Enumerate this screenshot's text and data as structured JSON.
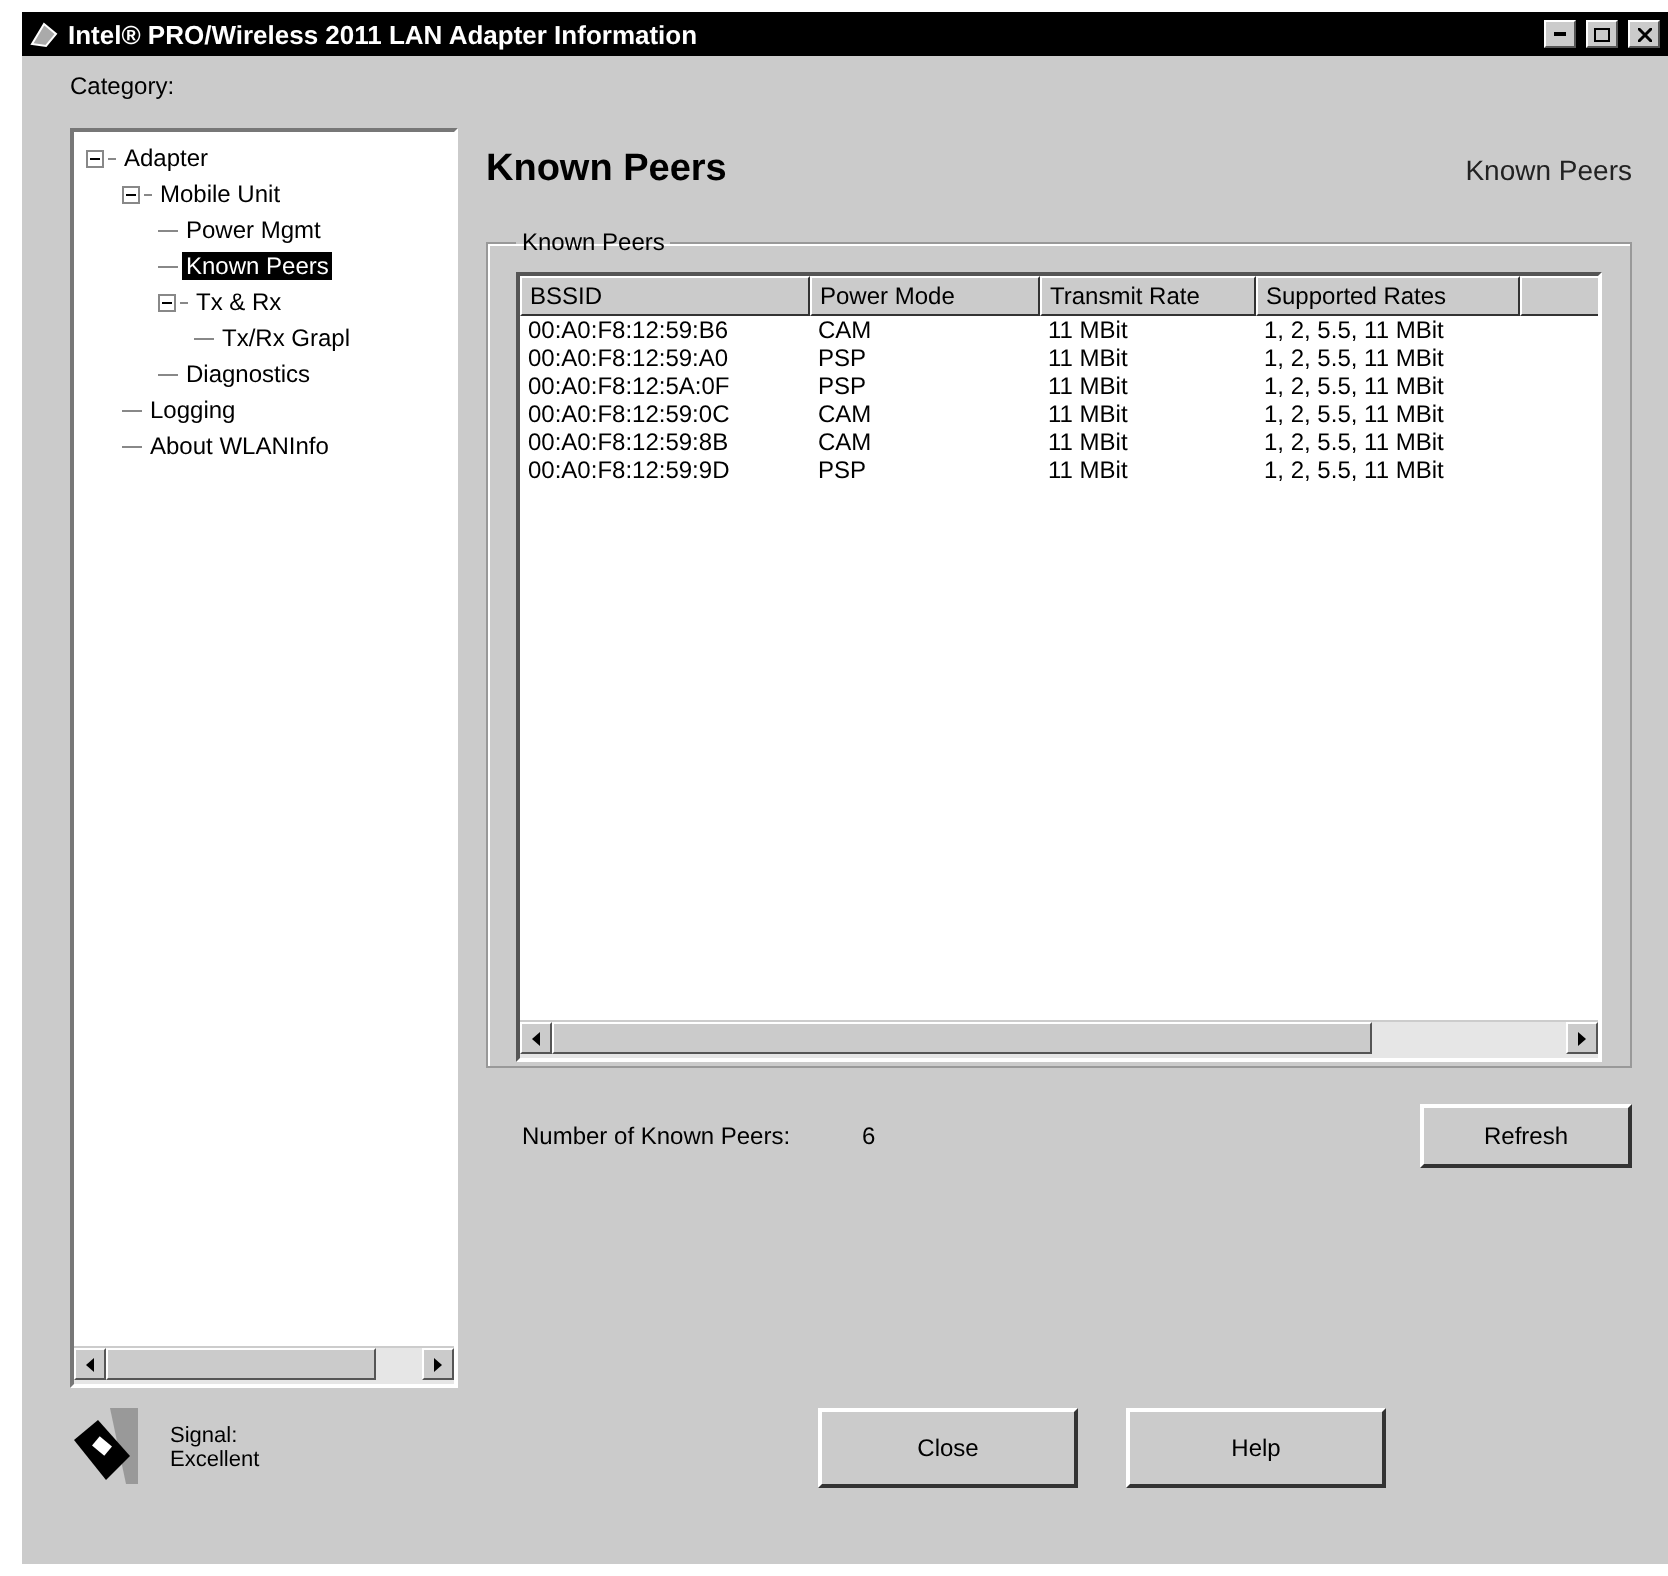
{
  "window": {
    "title": "Intel® PRO/Wireless 2011 LAN Adapter Information"
  },
  "category": {
    "label": "Category:"
  },
  "tree": [
    {
      "label": "Adapter",
      "expanded": true,
      "selected": false,
      "children": [
        {
          "label": "Mobile Unit",
          "expanded": true,
          "selected": false,
          "children": [
            {
              "label": "Power Mgmt",
              "selected": false
            },
            {
              "label": "Known Peers",
              "selected": true
            },
            {
              "label": "Tx & Rx",
              "expanded": true,
              "selected": false,
              "children": [
                {
                  "label": "Tx/Rx Grapl",
                  "selected": false
                }
              ]
            },
            {
              "label": "Diagnostics",
              "selected": false
            }
          ]
        },
        {
          "label": "Logging",
          "selected": false
        },
        {
          "label": "About WLANInfo",
          "selected": false
        }
      ]
    }
  ],
  "page": {
    "heading": "Known Peers",
    "caption": "Known Peers"
  },
  "group": {
    "label": "Known Peers"
  },
  "table": {
    "columns": [
      "BSSID",
      "Power Mode",
      "Transmit Rate",
      "Supported Rates"
    ],
    "rows": [
      [
        "00:A0:F8:12:59:B6",
        "CAM",
        "11 MBit",
        "1, 2, 5.5, 11 MBit"
      ],
      [
        "00:A0:F8:12:59:A0",
        "PSP",
        "11 MBit",
        "1, 2, 5.5, 11 MBit"
      ],
      [
        "00:A0:F8:12:5A:0F",
        "PSP",
        "11 MBit",
        "1, 2, 5.5, 11 MBit"
      ],
      [
        "00:A0:F8:12:59:0C",
        "CAM",
        "11 MBit",
        "1, 2, 5.5, 11 MBit"
      ],
      [
        "00:A0:F8:12:59:8B",
        "CAM",
        "11 MBit",
        "1, 2, 5.5, 11 MBit"
      ],
      [
        "00:A0:F8:12:59:9D",
        "PSP",
        "11 MBit",
        "1, 2, 5.5, 11 MBit"
      ]
    ]
  },
  "peer_count": {
    "label": "Number of Known Peers:",
    "value": "6"
  },
  "refresh_button": "Refresh",
  "signal": {
    "label": "Signal:",
    "value": "Excellent"
  },
  "buttons": [
    "Close",
    "Help"
  ]
}
